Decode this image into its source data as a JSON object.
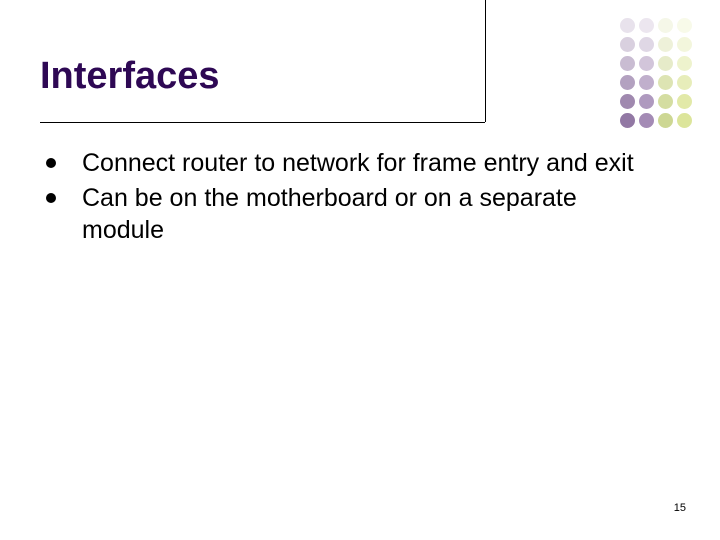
{
  "title": "Interfaces",
  "bullets": [
    "Connect router to network for frame entry and exit",
    "Can be on the motherboard or on a separate module"
  ],
  "page_number": "15"
}
